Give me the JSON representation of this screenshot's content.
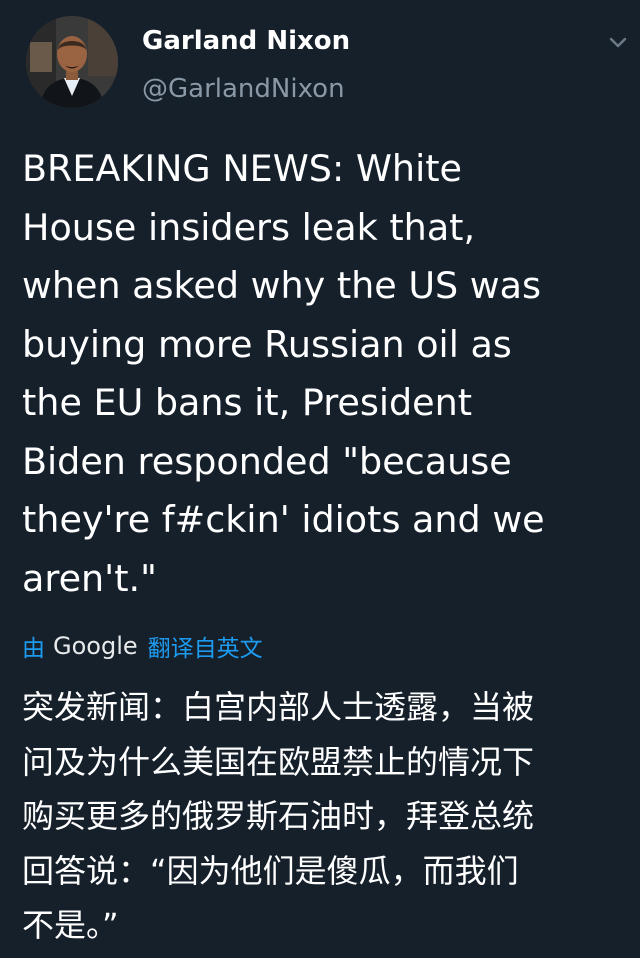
{
  "author": {
    "display_name": "Garland Nixon",
    "handle": "@GarlandNixon",
    "avatar_icon": "profile-photo"
  },
  "tweet": {
    "lines": [
      "BREAKING NEWS: White",
      "House insiders leak that,",
      "when asked why the US was",
      "buying more Russian oil as",
      "the EU bans it, President",
      "Biden responded \"because",
      "they're f#ckin' idiots and we",
      "aren't.\""
    ]
  },
  "translation": {
    "by_label": "由",
    "provider": "Google",
    "from_label": "翻译自英文",
    "lines": [
      "突发新闻：白宫内部人士透露，当被",
      "问及为什么美国在欧盟禁止的情况下",
      "购买更多的俄罗斯石油时，拜登总统",
      "回答说：“因为他们是傻瓜，而我们",
      "不是。”"
    ]
  },
  "colors": {
    "background": "#15202b",
    "accent": "#1d9bf0",
    "secondary_text": "#8b98a5"
  },
  "icons": {
    "more": "chevron-down-icon"
  }
}
